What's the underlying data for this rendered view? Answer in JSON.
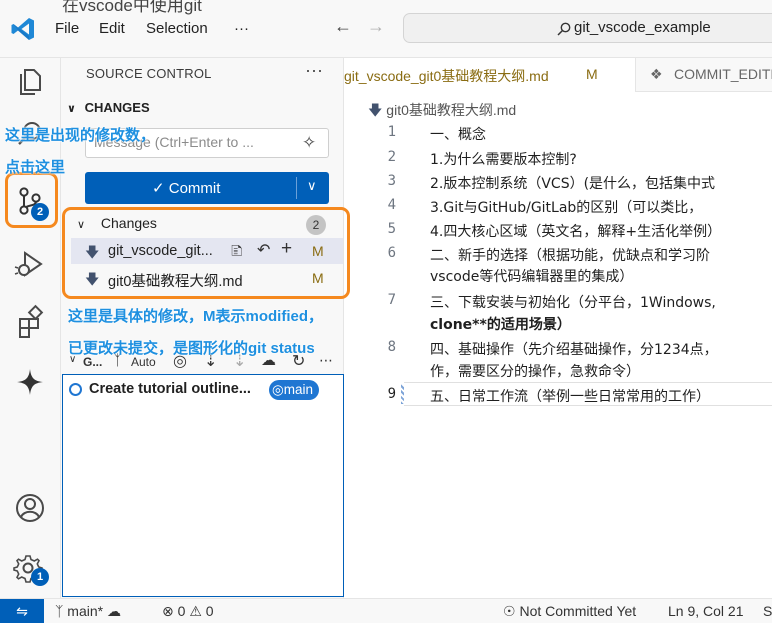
{
  "window": {
    "overlay_title": "在vscode中使用git",
    "menus": [
      "File",
      "Edit",
      "Selection",
      "···"
    ],
    "search": "git_vscode_example"
  },
  "activity": {
    "scm_badge": "2",
    "settings_badge": "1"
  },
  "sidebar": {
    "title": "SOURCE CONTROL",
    "more": "···",
    "section": "CHANGES",
    "message_placeholder": "Message (Ctrl+Enter to ...",
    "commit_label": "Commit",
    "group_label": "Changes",
    "group_count": "2",
    "files": [
      {
        "name": "git_vscode_git...",
        "status": "M"
      },
      {
        "name": "git0基础教程大纲.md",
        "status": "M"
      }
    ],
    "graph_title": "G...",
    "graph_auto": "Auto",
    "graph_item": "Create tutorial outline...",
    "graph_branch": "main"
  },
  "editor": {
    "tabs": [
      {
        "label": "git_vscode_git0基础教程大纲.md",
        "status": "M"
      },
      {
        "label": "COMMIT_EDITMSG"
      }
    ],
    "breadcrumb": "git0基础教程大纲.md",
    "lines": [
      {
        "n": "1",
        "text": "一、概念"
      },
      {
        "n": "2",
        "text": "1.为什么需要版本控制?"
      },
      {
        "n": "3",
        "text": "2.版本控制系统（VCS）(是什么，包括集中式"
      },
      {
        "n": "4",
        "text": "3.Git与GitHub/GitLab的区别（可以类比，"
      },
      {
        "n": "5",
        "text": "4.四大核心区域（英文名，解释+生活化举例）"
      },
      {
        "n": "6",
        "text": "二、新手的选择（根据功能，优缺点和学习阶"
      },
      {
        "n": "",
        "text": "vscode等代码编辑器里的集成）"
      },
      {
        "n": "7",
        "text": "三、下载安装与初始化（分平台，1Windows,"
      },
      {
        "n": "",
        "text": "clone**的适用场景）"
      },
      {
        "n": "8",
        "text": "四、基础操作（先介绍基础操作，分1234点，"
      },
      {
        "n": "",
        "text": "作，需要区分的操作，急救命令）"
      },
      {
        "n": "9",
        "text": "五、日常工作流（举例一些日常常用的工作）"
      }
    ]
  },
  "statusbar": {
    "branch": "main*",
    "errors": "0",
    "warnings": "0",
    "commit_status": "Not Committed Yet",
    "position": "Ln 9, Col 21",
    "extra": "S"
  },
  "annotations": {
    "scm_note_1": "这里是出现的修改数，",
    "scm_note_2": "点击这里",
    "changes_note_1": "这里是具体的修改，M表示modified，",
    "changes_note_2": "已更改未提交，是图形化的git status"
  },
  "colors": {
    "accent": "#005fb8",
    "annotation_box": "#f5891f",
    "annotation_text": "#1e90e0",
    "modified": "#8a6c12"
  }
}
